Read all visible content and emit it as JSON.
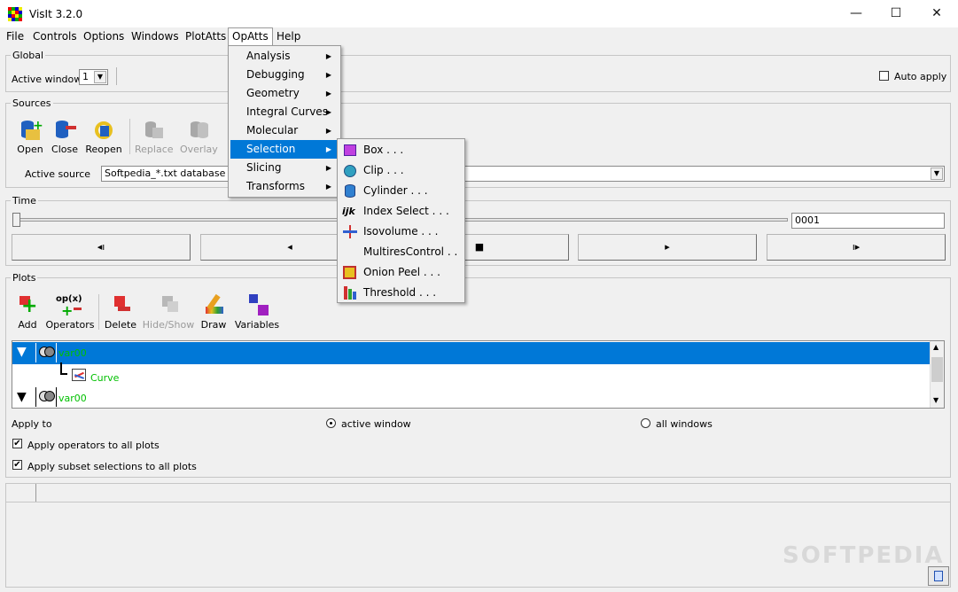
{
  "window": {
    "title": "VisIt 3.2.0",
    "minimize_glyph": "—",
    "maximize_glyph": "☐",
    "close_glyph": "✕"
  },
  "menubar": [
    "File",
    "Controls",
    "Options",
    "Windows",
    "PlotAtts",
    "OpAtts",
    "Help"
  ],
  "global": {
    "label": "Global",
    "active_window_label": "Active window",
    "active_window_value": "1",
    "auto_apply_label": "Auto apply"
  },
  "sources": {
    "label": "Sources",
    "tools": [
      {
        "label": "Open",
        "icon": "open-icon",
        "enabled": true
      },
      {
        "label": "Close",
        "icon": "close-db-icon",
        "enabled": true
      },
      {
        "label": "Reopen",
        "icon": "reopen-icon",
        "enabled": true
      },
      {
        "label": "Replace",
        "icon": "replace-icon",
        "enabled": false
      },
      {
        "label": "Overlay",
        "icon": "overlay-icon",
        "enabled": false
      }
    ],
    "active_source_label": "Active source",
    "active_source_value": "Softpedia_*.txt database"
  },
  "time": {
    "label": "Time",
    "frame_value": "0001",
    "buttons": [
      "◂ı",
      "◂",
      "■",
      "▸",
      "ı▸"
    ]
  },
  "plots": {
    "label": "Plots",
    "tools": [
      {
        "label": "Add",
        "icon": "add-plot-icon",
        "enabled": true
      },
      {
        "label": "Operators",
        "icon": "operators-icon",
        "enabled": true
      },
      {
        "label": "Delete",
        "icon": "delete-icon",
        "enabled": true
      },
      {
        "label": "Hide/Show",
        "icon": "hide-show-icon",
        "enabled": false
      },
      {
        "label": "Draw",
        "icon": "draw-icon",
        "enabled": true
      },
      {
        "label": "Variables",
        "icon": "variables-icon",
        "enabled": true
      }
    ],
    "operators_icon_text": "op(x)",
    "list": [
      {
        "name": "var00",
        "selected": true
      },
      {
        "name": "Curve",
        "child": true
      },
      {
        "name": "var00",
        "selected": false
      }
    ],
    "apply_to_label": "Apply to",
    "radio_active": "active window",
    "radio_all": "all windows",
    "check_operators": "Apply operators to all plots",
    "check_subset": "Apply subset selections to all plots"
  },
  "opatts_menu": [
    {
      "label": "Analysis"
    },
    {
      "label": "Debugging"
    },
    {
      "label": "Geometry"
    },
    {
      "label": "Integral Curves"
    },
    {
      "label": "Molecular"
    },
    {
      "label": "Selection",
      "selected": true
    },
    {
      "label": "Slicing"
    },
    {
      "label": "Transforms"
    }
  ],
  "selection_menu": [
    {
      "label": "Box . . .",
      "icon": "box-icon"
    },
    {
      "label": "Clip . . .",
      "icon": "clip-icon"
    },
    {
      "label": "Cylinder . . .",
      "icon": "cylinder-icon"
    },
    {
      "label": "Index Select . . .",
      "icon": "index-select-icon",
      "icon_text": "ijk"
    },
    {
      "label": "Isovolume . . .",
      "icon": "isovolume-icon"
    },
    {
      "label": "MultiresControl . . .",
      "icon": ""
    },
    {
      "label": "Onion Peel . . .",
      "icon": "onion-peel-icon"
    },
    {
      "label": "Threshold . . .",
      "icon": "threshold-icon"
    }
  ],
  "watermark": "SOFTPEDIA",
  "colors": {
    "accent": "#0078d7",
    "plot_text": "#00c000"
  }
}
